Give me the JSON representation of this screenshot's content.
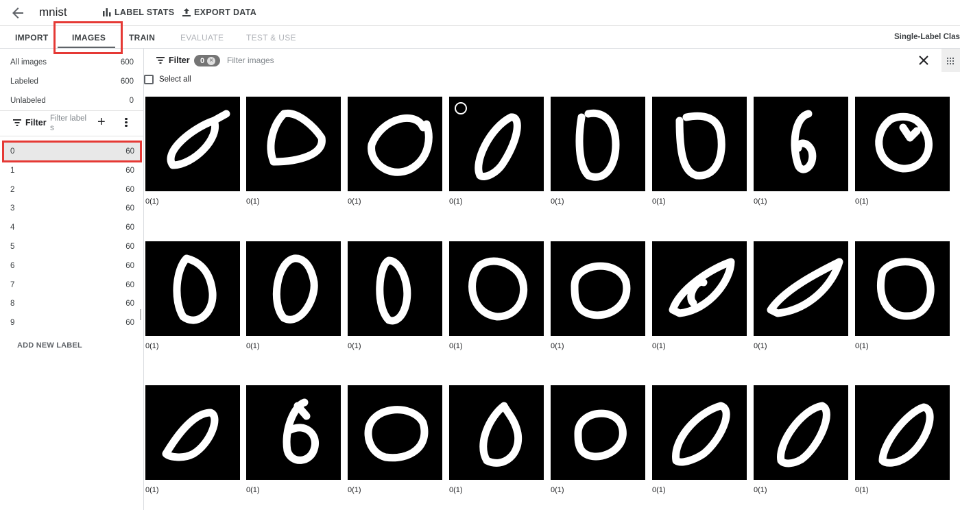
{
  "header": {
    "dataset_name": "mnist",
    "label_stats": "LABEL STATS",
    "export_data": "EXPORT DATA"
  },
  "tabs": [
    {
      "label": "IMPORT",
      "enabled": true
    },
    {
      "label": "IMAGES",
      "enabled": true,
      "active": true
    },
    {
      "label": "TRAIN",
      "enabled": true
    },
    {
      "label": "EVALUATE",
      "enabled": false
    },
    {
      "label": "TEST & USE",
      "enabled": false
    }
  ],
  "mode_label": "Single-Label Classifi",
  "counts": [
    {
      "name": "All images",
      "value": "600"
    },
    {
      "name": "Labeled",
      "value": "600"
    },
    {
      "name": "Unlabeled",
      "value": "0"
    }
  ],
  "label_filter": {
    "label": "Filter",
    "placeholder": "Filter labels"
  },
  "labels": [
    {
      "name": "0",
      "count": "60",
      "selected": true
    },
    {
      "name": "1",
      "count": "60"
    },
    {
      "name": "2",
      "count": "60"
    },
    {
      "name": "3",
      "count": "60"
    },
    {
      "name": "4",
      "count": "60"
    },
    {
      "name": "5",
      "count": "60"
    },
    {
      "name": "6",
      "count": "60"
    },
    {
      "name": "7",
      "count": "60"
    },
    {
      "name": "8",
      "count": "60"
    },
    {
      "name": "9",
      "count": "60"
    }
  ],
  "add_new_label": "ADD NEW LABEL",
  "image_filter": {
    "label": "Filter",
    "chip_count": "0",
    "placeholder": "Filter images"
  },
  "select_all": "Select all",
  "image_caption": "0(1)",
  "images": [
    {
      "caption": "0(1)",
      "shape": "slant-loop"
    },
    {
      "caption": "0(1)",
      "shape": "triangle"
    },
    {
      "caption": "0(1)",
      "shape": "open-c"
    },
    {
      "caption": "0(1)",
      "shape": "slant"
    },
    {
      "caption": "0(1)",
      "shape": "tall"
    },
    {
      "caption": "0(1)",
      "shape": "round-tall"
    },
    {
      "caption": "0(1)",
      "shape": "six"
    },
    {
      "caption": "0(1)",
      "shape": "round-hook"
    },
    {
      "caption": "0(1)",
      "shape": "egg"
    },
    {
      "caption": "0(1)",
      "shape": "oval"
    },
    {
      "caption": "0(1)",
      "shape": "narrow"
    },
    {
      "caption": "0(1)",
      "shape": "bumpy"
    },
    {
      "caption": "0(1)",
      "shape": "thick-round"
    },
    {
      "caption": "0(1)",
      "shape": "leaf"
    },
    {
      "caption": "0(1)",
      "shape": "leaf-flat"
    },
    {
      "caption": "0(1)",
      "shape": "thick-square"
    },
    {
      "caption": "0(1)",
      "shape": "kite"
    },
    {
      "caption": "0(1)",
      "shape": "six-loop"
    },
    {
      "caption": "0(1)",
      "shape": "fat-blob"
    },
    {
      "caption": "0(1)",
      "shape": "drop"
    },
    {
      "caption": "0(1)",
      "shape": "ring"
    },
    {
      "caption": "0(1)",
      "shape": "slant-wide"
    },
    {
      "caption": "0(1)",
      "shape": "slant-thin"
    },
    {
      "caption": "0(1)",
      "shape": "slant-right"
    }
  ],
  "colors": {
    "highlight": "#e53935",
    "chip": "#757575",
    "thumb_bg": "#000000",
    "stroke": "#ffffff"
  }
}
